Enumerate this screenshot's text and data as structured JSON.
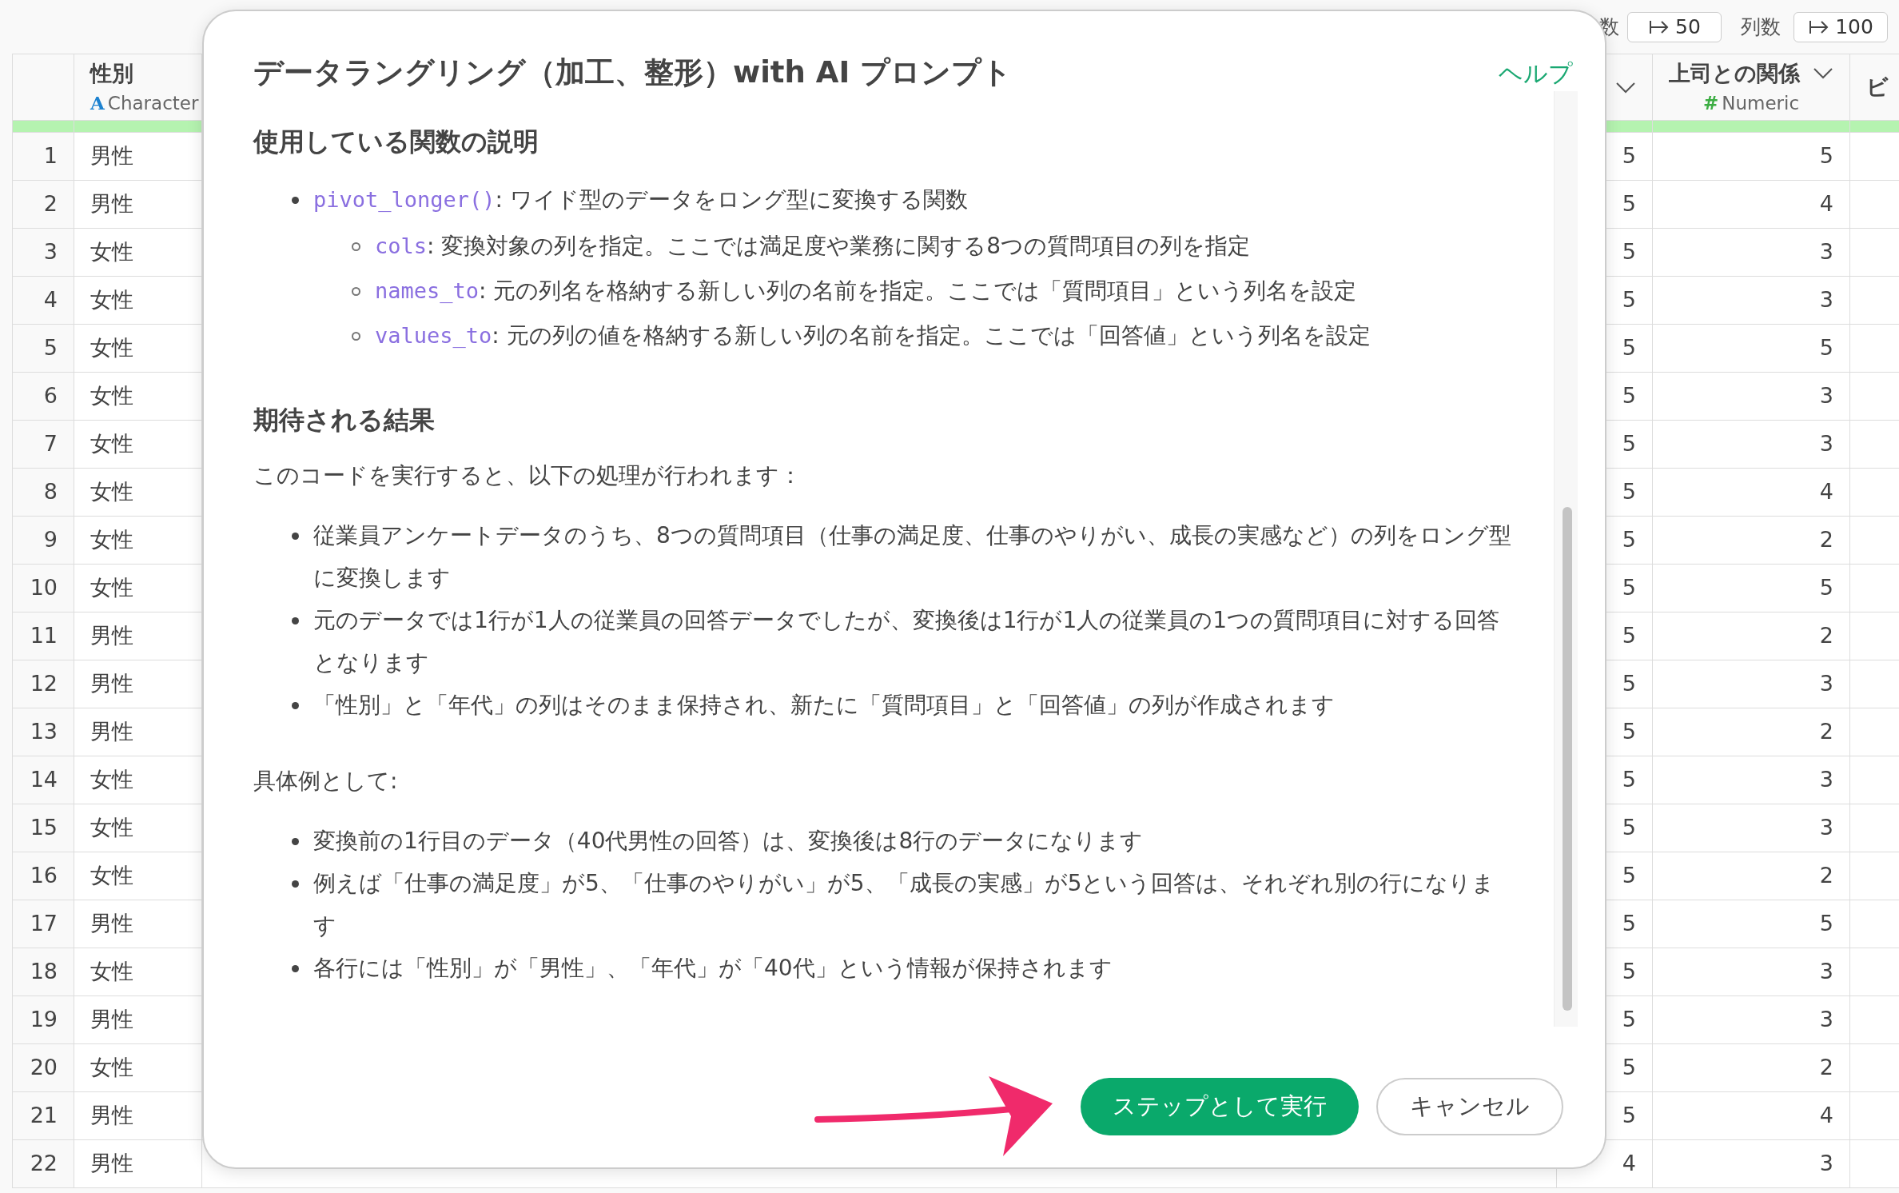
{
  "toolbar": {
    "row_count_label": "数",
    "row_count_value": "50",
    "column_count_label": "列数",
    "column_count_value": "100"
  },
  "table": {
    "columns": [
      {
        "kind": "character",
        "name": "性別",
        "type_icon": "A",
        "type": "Character"
      },
      {
        "kind": "covered"
      },
      {
        "kind": "numeric",
        "name": "上司との関係",
        "type_icon": "#",
        "type": "Numeric"
      },
      {
        "kind": "cut",
        "name": "ビ"
      }
    ],
    "rows": [
      {
        "number": "1",
        "cells": [
          "男性",
          "5",
          "5"
        ]
      },
      {
        "number": "2",
        "cells": [
          "男性",
          "5",
          "4"
        ]
      },
      {
        "number": "3",
        "cells": [
          "女性",
          "5",
          "3"
        ]
      },
      {
        "number": "4",
        "cells": [
          "女性",
          "5",
          "3"
        ]
      },
      {
        "number": "5",
        "cells": [
          "女性",
          "5",
          "5"
        ]
      },
      {
        "number": "6",
        "cells": [
          "女性",
          "5",
          "3"
        ]
      },
      {
        "number": "7",
        "cells": [
          "女性",
          "5",
          "3"
        ]
      },
      {
        "number": "8",
        "cells": [
          "女性",
          "5",
          "4"
        ]
      },
      {
        "number": "9",
        "cells": [
          "女性",
          "5",
          "2"
        ]
      },
      {
        "number": "10",
        "cells": [
          "女性",
          "5",
          "5"
        ]
      },
      {
        "number": "11",
        "cells": [
          "男性",
          "5",
          "2"
        ]
      },
      {
        "number": "12",
        "cells": [
          "男性",
          "5",
          "3"
        ]
      },
      {
        "number": "13",
        "cells": [
          "男性",
          "5",
          "2"
        ]
      },
      {
        "number": "14",
        "cells": [
          "女性",
          "5",
          "3"
        ]
      },
      {
        "number": "15",
        "cells": [
          "女性",
          "5",
          "3"
        ]
      },
      {
        "number": "16",
        "cells": [
          "女性",
          "5",
          "2"
        ]
      },
      {
        "number": "17",
        "cells": [
          "男性",
          "5",
          "5"
        ]
      },
      {
        "number": "18",
        "cells": [
          "女性",
          "5",
          "3"
        ]
      },
      {
        "number": "19",
        "cells": [
          "男性",
          "5",
          "3"
        ]
      },
      {
        "number": "20",
        "cells": [
          "女性",
          "5",
          "2"
        ]
      },
      {
        "number": "21",
        "cells": [
          "男性",
          "5",
          "4"
        ]
      },
      {
        "number": "22",
        "cells": [
          "男性",
          "4",
          "3"
        ]
      }
    ]
  },
  "dialog": {
    "title": "データラングリング（加工、整形）with AI プロンプト",
    "help_link": "ヘルプ",
    "sections": [
      {
        "kind": "heading",
        "text": "使用している関数の説明"
      },
      {
        "kind": "list",
        "items": [
          {
            "code": "pivot_longer()",
            "text": ": ワイド型のデータをロング型に変換する関数",
            "children": [
              {
                "code": "cols",
                "text": ": 変換対象の列を指定。ここでは満足度や業務に関する8つの質問項目の列を指定"
              },
              {
                "code": "names_to",
                "text": ": 元の列名を格納する新しい列の名前を指定。ここでは「質問項目」という列名を設定"
              },
              {
                "code": "values_to",
                "text": ": 元の列の値を格納する新しい列の名前を指定。ここでは「回答値」という列名を設定"
              }
            ]
          }
        ]
      },
      {
        "kind": "heading",
        "text": "期待される結果"
      },
      {
        "kind": "paragraph",
        "text": "このコードを実行すると、以下の処理が行われます："
      },
      {
        "kind": "list",
        "items": [
          {
            "text": "従業員アンケートデータのうち、8つの質問項目（仕事の満足度、仕事のやりがい、成長の実感など）の列をロング型に変換します"
          },
          {
            "text": "元のデータでは1行が1人の従業員の回答データでしたが、変換後は1行が1人の従業員の1つの質問項目に対する回答となります"
          },
          {
            "text": "「性別」と「年代」の列はそのまま保持され、新たに「質問項目」と「回答値」の列が作成されます"
          }
        ]
      },
      {
        "kind": "paragraph",
        "text": "具体例として:"
      },
      {
        "kind": "list",
        "items": [
          {
            "text": "変換前の1行目のデータ（40代男性の回答）は、変換後は8行のデータになります"
          },
          {
            "text": "例えば「仕事の満足度」が5、「仕事のやりがい」が5、「成長の実感」が5という回答は、それぞれ別の行になります"
          },
          {
            "text": "各行には「性別」が「男性」、「年代」が「40代」という情報が保持されます"
          }
        ]
      }
    ],
    "buttons": [
      {
        "kind": "primary",
        "label": "ステップとして実行"
      },
      {
        "kind": "secondary",
        "label": "キャンセル"
      }
    ]
  }
}
